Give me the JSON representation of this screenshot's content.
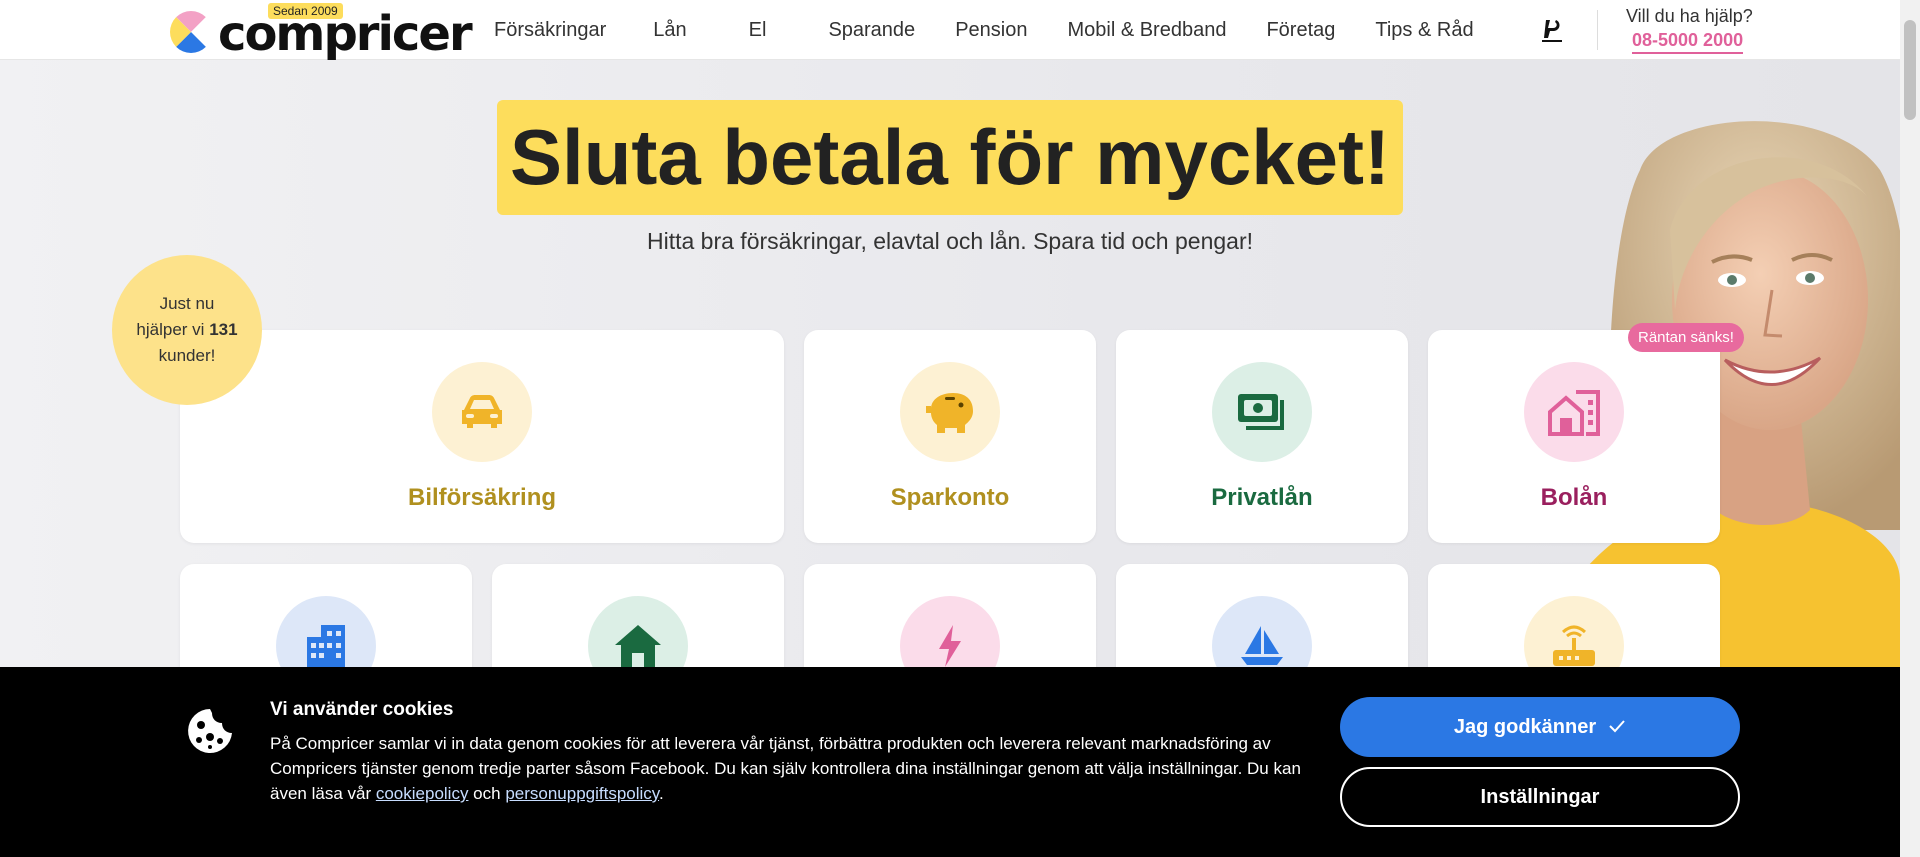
{
  "header": {
    "logo_text": "compricer",
    "logo_badge": "Sedan 2009",
    "nav": [
      "Försäkringar",
      "Lån",
      "El",
      "Sparande",
      "Pension",
      "Mobil & Bredband",
      "Företag",
      "Tips & Råd"
    ],
    "help_text": "Vill du ha hjälp?",
    "help_phone": "08-5000 2000"
  },
  "hero": {
    "title": "Sluta betala för mycket!",
    "subtitle": "Hitta bra försäkringar, elavtal och lån. Spara tid och pengar!",
    "helper": {
      "line1": "Just nu",
      "line2_prefix": "hjälper vi ",
      "count": "131",
      "line3": "kunder!"
    },
    "ribbon": "Räntan sänks!"
  },
  "cards": [
    {
      "label": "Bilförsäkring",
      "icon": "car-icon",
      "color": "#b0901f",
      "bg": "#fdf1d3"
    },
    {
      "label": "Sparkonto",
      "icon": "piggy-bank-icon",
      "color": "#b0901f",
      "bg": "#fdf1d3"
    },
    {
      "label": "Privatlån",
      "icon": "money-icon",
      "color": "#1a6a40",
      "bg": "#dcefe6"
    },
    {
      "label": "Bolån",
      "icon": "house-building-icon",
      "color": "#9a1f5e",
      "bg": "#fbdcea"
    }
  ],
  "cards_row2": [
    {
      "icon": "office-building-icon",
      "bg": "#dde7f8"
    },
    {
      "icon": "house-icon",
      "bg": "#dcefe6"
    },
    {
      "icon": "lightning-icon",
      "bg": "#fbdcea"
    },
    {
      "icon": "sailboat-icon",
      "bg": "#dde7f8"
    },
    {
      "icon": "router-icon",
      "bg": "#fdf1d3"
    }
  ],
  "cookie": {
    "title": "Vi använder cookies",
    "text_part1": "På Compricer samlar vi in data genom cookies för att leverera vår tjänst, förbättra produkten och leverera relevant marknadsföring av Compricers tjänster genom tredje parter såsom Facebook. Du kan själv kontrollera dina inställningar genom att välja inställningar. Du kan även läsa vår ",
    "link1": "cookiepolicy",
    "text_part2": " och ",
    "link2": "personuppgiftspolicy",
    "text_part3": ".",
    "accept_label": "Jag godkänner",
    "settings_label": "Inställningar"
  },
  "colors": {
    "accent_yellow": "#fddd5c",
    "pink": "#e0609a",
    "button_blue": "#2b78e4"
  }
}
